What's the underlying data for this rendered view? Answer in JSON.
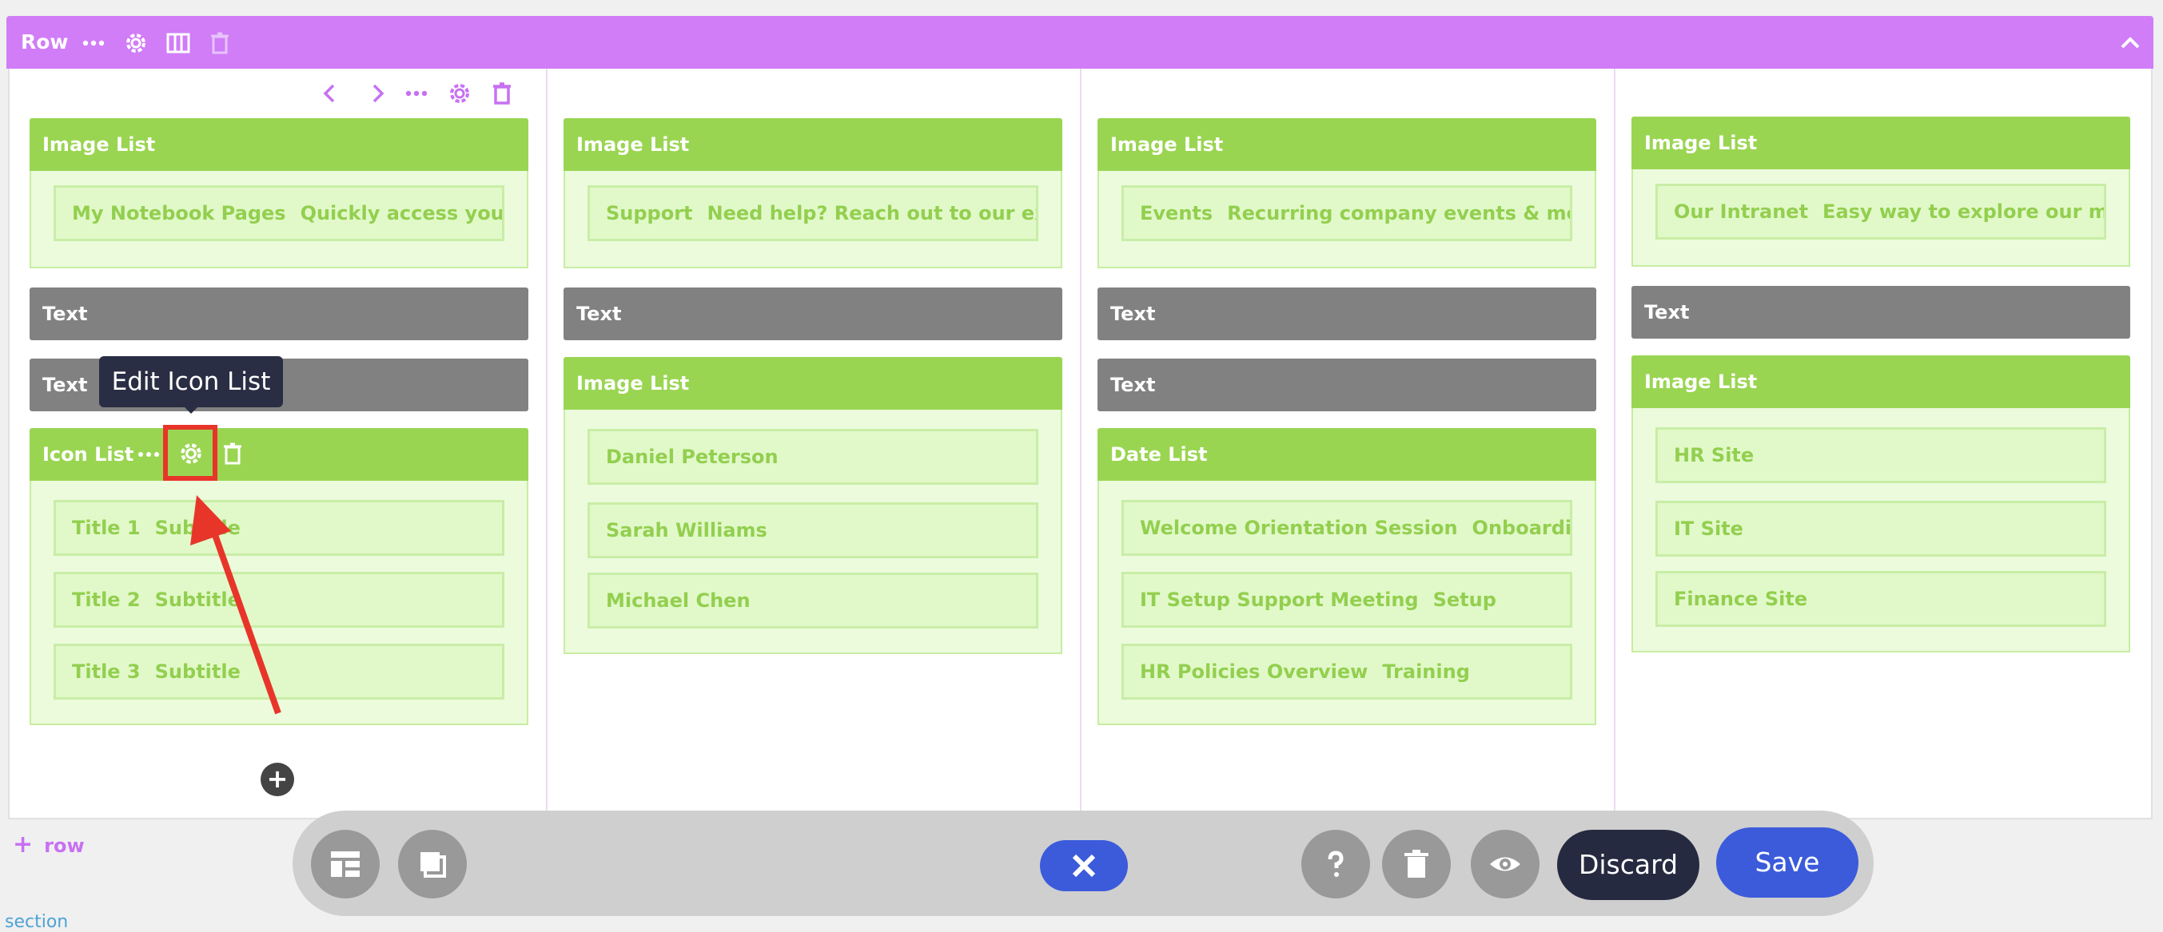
{
  "row_bar": {
    "label": "Row",
    "icons": [
      "more-dots-icon",
      "gear-icon",
      "columns-icon",
      "trash-icon",
      "chevron-up-icon"
    ],
    "color": "#d07df7"
  },
  "column_toolbar": {
    "icons": [
      "chevron-left-icon",
      "chevron-right-icon",
      "more-dots-icon",
      "gear-icon",
      "trash-icon"
    ]
  },
  "columns": [
    {
      "modules": [
        {
          "type": "green",
          "title": "Image List",
          "items": [
            {
              "title": "My Notebook Pages",
              "subtitle": "Quickly access your O..."
            }
          ]
        },
        {
          "type": "gray",
          "title": "Text"
        },
        {
          "type": "gray",
          "title": "Text"
        },
        {
          "type": "green",
          "title": "Icon List",
          "items": [
            {
              "title": "Title 1",
              "subtitle": "Subtitle"
            },
            {
              "title": "Title 2",
              "subtitle": "Subtitle"
            },
            {
              "title": "Title 3",
              "subtitle": "Subtitle"
            }
          ]
        }
      ]
    },
    {
      "modules": [
        {
          "type": "green",
          "title": "Image List",
          "items": [
            {
              "title": "Support",
              "subtitle": "Need help? Reach out to our exper..."
            }
          ]
        },
        {
          "type": "gray",
          "title": "Text"
        },
        {
          "type": "green",
          "title": "Image List",
          "items": [
            {
              "title": "Daniel Peterson",
              "subtitle": ""
            },
            {
              "title": "Sarah Williams",
              "subtitle": ""
            },
            {
              "title": "Michael Chen",
              "subtitle": ""
            }
          ]
        }
      ]
    },
    {
      "modules": [
        {
          "type": "green",
          "title": "Image List",
          "items": [
            {
              "title": "Events",
              "subtitle": "Recurring company events & meeti..."
            }
          ]
        },
        {
          "type": "gray",
          "title": "Text"
        },
        {
          "type": "gray",
          "title": "Text"
        },
        {
          "type": "green",
          "title": "Date List",
          "items": [
            {
              "title": "Welcome Orientation Session",
              "subtitle": "Onboarding"
            },
            {
              "title": "IT Setup Support Meeting",
              "subtitle": "Setup"
            },
            {
              "title": "HR Policies Overview",
              "subtitle": "Training"
            }
          ]
        }
      ]
    },
    {
      "modules": [
        {
          "type": "green",
          "title": "Image List",
          "items": [
            {
              "title": "Our Intranet",
              "subtitle": "Easy way to explore our most ..."
            }
          ]
        },
        {
          "type": "gray",
          "title": "Text"
        },
        {
          "type": "green",
          "title": "Image List",
          "items": [
            {
              "title": "HR Site",
              "subtitle": ""
            },
            {
              "title": "IT Site",
              "subtitle": ""
            },
            {
              "title": "Finance Site",
              "subtitle": ""
            }
          ]
        }
      ]
    }
  ],
  "icon_list_toolbar_icons": [
    "more-dots-icon",
    "gear-icon",
    "trash-icon"
  ],
  "tooltip": "Edit Icon List",
  "add_row_label": "row",
  "section_label": "section",
  "bottom_toolbar": {
    "left_icons": [
      "layout-icon",
      "copy-icon"
    ],
    "close_icon": "close-icon",
    "right_icons": [
      "help-icon",
      "trash-icon",
      "eye-icon"
    ],
    "discard_label": "Discard",
    "save_label": "Save"
  },
  "colors": {
    "row_accent": "#d07df7",
    "module_green": "#9ad552",
    "module_gray": "#818181",
    "annotation_red": "#e8352a",
    "primary_blue": "#3b5bdb",
    "dark_button": "#262a40"
  }
}
